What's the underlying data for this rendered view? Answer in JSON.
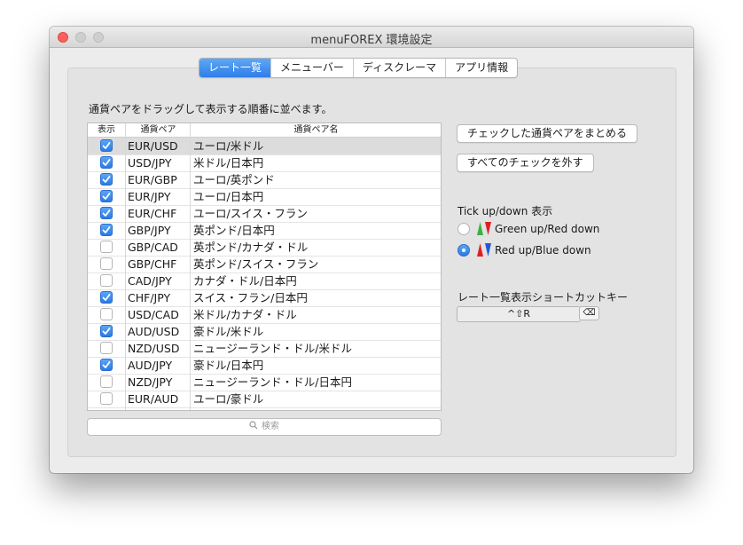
{
  "window": {
    "title": "menuFOREX 環境設定"
  },
  "tabs": [
    {
      "label": "レート一覧",
      "active": true
    },
    {
      "label": "メニューバー",
      "active": false
    },
    {
      "label": "ディスクレーマ",
      "active": false
    },
    {
      "label": "アプリ情報",
      "active": false
    }
  ],
  "rates": {
    "instruction": "通貨ペアをドラッグして表示する順番に並べます。",
    "columns": {
      "show": "表示",
      "pair": "通貨ペア",
      "name": "通貨ペア名"
    },
    "rows": [
      {
        "pair": "EUR/USD",
        "name": "ユーロ/米ドル",
        "checked": true
      },
      {
        "pair": "USD/JPY",
        "name": "米ドル/日本円",
        "checked": true
      },
      {
        "pair": "EUR/GBP",
        "name": "ユーロ/英ポンド",
        "checked": true
      },
      {
        "pair": "EUR/JPY",
        "name": "ユーロ/日本円",
        "checked": true
      },
      {
        "pair": "EUR/CHF",
        "name": "ユーロ/スイス・フラン",
        "checked": true
      },
      {
        "pair": "GBP/JPY",
        "name": "英ポンド/日本円",
        "checked": true
      },
      {
        "pair": "GBP/CAD",
        "name": "英ポンド/カナダ・ドル",
        "checked": false
      },
      {
        "pair": "GBP/CHF",
        "name": "英ポンド/スイス・フラン",
        "checked": false
      },
      {
        "pair": "CAD/JPY",
        "name": "カナダ・ドル/日本円",
        "checked": false
      },
      {
        "pair": "CHF/JPY",
        "name": "スイス・フラン/日本円",
        "checked": true
      },
      {
        "pair": "USD/CAD",
        "name": "米ドル/カナダ・ドル",
        "checked": false
      },
      {
        "pair": "AUD/USD",
        "name": "豪ドル/米ドル",
        "checked": true
      },
      {
        "pair": "NZD/USD",
        "name": "ニュージーランド・ドル/米ドル",
        "checked": false
      },
      {
        "pair": "AUD/JPY",
        "name": "豪ドル/日本円",
        "checked": true
      },
      {
        "pair": "NZD/JPY",
        "name": "ニュージーランド・ドル/日本円",
        "checked": false
      },
      {
        "pair": "EUR/AUD",
        "name": "ユーロ/豪ドル",
        "checked": false
      }
    ],
    "search_placeholder": "検索",
    "search_icon": "magnifier-icon"
  },
  "actions": {
    "group_checked": "チェックした通貨ペアをまとめる",
    "uncheck_all": "すべてのチェックを外す"
  },
  "tick": {
    "label": "Tick up/down 表示",
    "options": [
      {
        "label": "Green up/Red down",
        "selected": false,
        "up_color": "#3cb043",
        "down_color": "#e02020"
      },
      {
        "label": "Red up/Blue down",
        "selected": true,
        "up_color": "#e02020",
        "down_color": "#2257d9"
      }
    ]
  },
  "shortcut": {
    "label": "レート一覧表示ショートカットキー",
    "value": "^⇧R",
    "clear_icon": "⌫"
  }
}
